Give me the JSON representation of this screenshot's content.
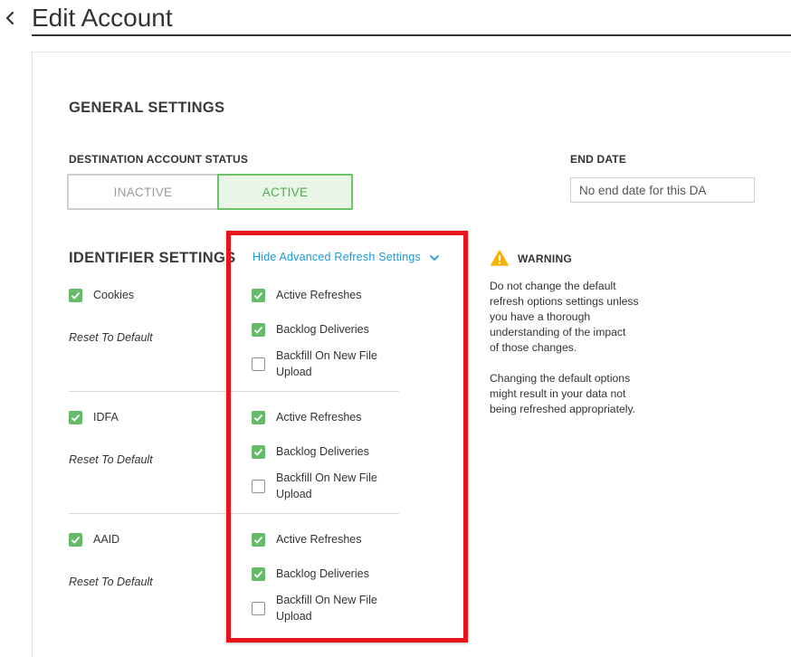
{
  "header": {
    "title": "Edit Account"
  },
  "general": {
    "heading": "GENERAL SETTINGS",
    "status_label": "DESTINATION ACCOUNT STATUS",
    "status_options": [
      "INACTIVE",
      "ACTIVE"
    ],
    "status_selected": "ACTIVE",
    "end_date_label": "END DATE",
    "end_date_placeholder": "No end date for this DA"
  },
  "identifier": {
    "heading": "IDENTIFIER SETTINGS",
    "advanced_toggle_label": "Hide Advanced Refresh Settings",
    "reset_label": "Reset To Default",
    "items": [
      {
        "name": "Cookies",
        "checked": true,
        "options": [
          {
            "label": "Active Refreshes",
            "checked": true
          },
          {
            "label": "Backlog Deliveries",
            "checked": true
          },
          {
            "label_line1": "Backfill On New File",
            "label_line2": "Upload",
            "checked": false
          }
        ]
      },
      {
        "name": "IDFA",
        "checked": true,
        "options": [
          {
            "label": "Active Refreshes",
            "checked": true
          },
          {
            "label": "Backlog Deliveries",
            "checked": true
          },
          {
            "label_line1": "Backfill On New File",
            "label_line2": "Upload",
            "checked": false
          }
        ]
      },
      {
        "name": "AAID",
        "checked": true,
        "options": [
          {
            "label": "Active Refreshes",
            "checked": true
          },
          {
            "label": "Backlog Deliveries",
            "checked": true
          },
          {
            "label_line1": "Backfill On New File",
            "label_line2": "Upload",
            "checked": false
          }
        ]
      }
    ]
  },
  "warning": {
    "title": "WARNING",
    "paragraph1_lines": [
      "Do not change the default",
      "refresh options settings unless",
      "you have a thorough",
      "understanding of the impact",
      "of those changes."
    ],
    "paragraph2_lines": [
      "Changing the default options",
      "might result in your data not",
      "being refreshed appropriately."
    ]
  },
  "colors": {
    "check_green": "#66bb6a",
    "link_blue": "#1a9ad6",
    "highlight_red": "#e8141c",
    "active_bg": "#e9f5e7",
    "warning_yellow": "#f5b400"
  },
  "icons": {
    "back": "chevron-left-icon",
    "expand": "chevron-down-icon",
    "warning": "warning-triangle-icon",
    "check": "checkmark-icon"
  }
}
